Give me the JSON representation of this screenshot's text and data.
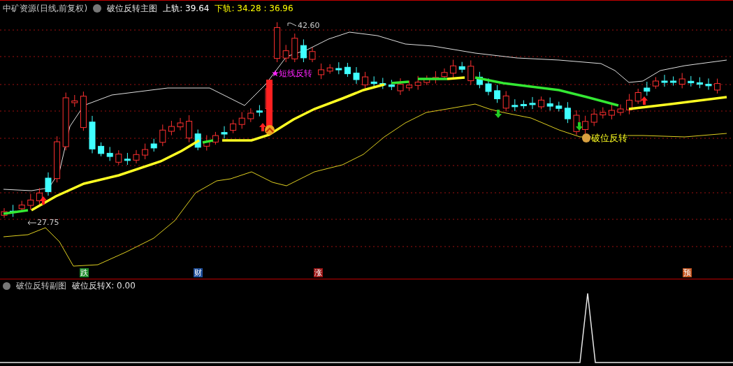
{
  "header": {
    "security": "中矿资源(日线,前复权)",
    "indicator": "破位反转主图",
    "upper": "上轨: 39.64",
    "lower": "下轨: 34.28 : 36.96"
  },
  "chart": {
    "high_label": "42.60",
    "low_label": "27.75",
    "signals": [
      {
        "kind": "star",
        "text": "短线反转"
      },
      {
        "kind": "bag",
        "text": "破位反转"
      }
    ],
    "markers": [
      {
        "text": "跌",
        "color": "#1d8a2a"
      },
      {
        "text": "财",
        "color": "#1f4f9a"
      },
      {
        "text": "涨",
        "color": "#9a1414"
      },
      {
        "text": "预",
        "color": "#c0501a"
      }
    ]
  },
  "sub": {
    "title": "破位反转副图",
    "series_label": "破位反转X: 0.00"
  }
}
